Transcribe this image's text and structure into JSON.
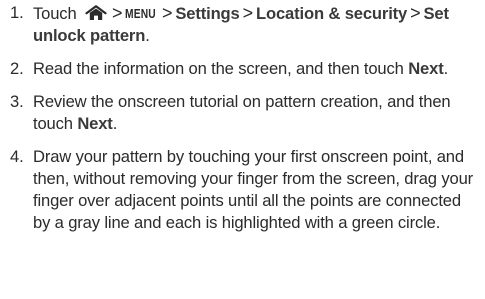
{
  "steps": [
    {
      "number": "1.",
      "pre": "Touch",
      "icon": "home-icon",
      "separators": [
        ">",
        ">",
        ">",
        ">"
      ],
      "menu_key": "MENU",
      "settings": "Settings",
      "location_security": "Location & security",
      "set_unlock_pattern": "Set unlock pattern",
      "end": "."
    },
    {
      "number": "2.",
      "text_before": "Read the information on the screen, and then touch",
      "bold": "Next",
      "text_after": "."
    },
    {
      "number": "3.",
      "text_before": "Review the onscreen tutorial on pattern creation, and then touch",
      "bold": "Next",
      "text_after": "."
    },
    {
      "number": "4.",
      "text": "Draw your pattern by touching your first onscreen point, and then, without removing your finger from the screen, drag your finger over adjacent points until all the points are connected by a gray line and each is highlighted with a green circle."
    }
  ]
}
